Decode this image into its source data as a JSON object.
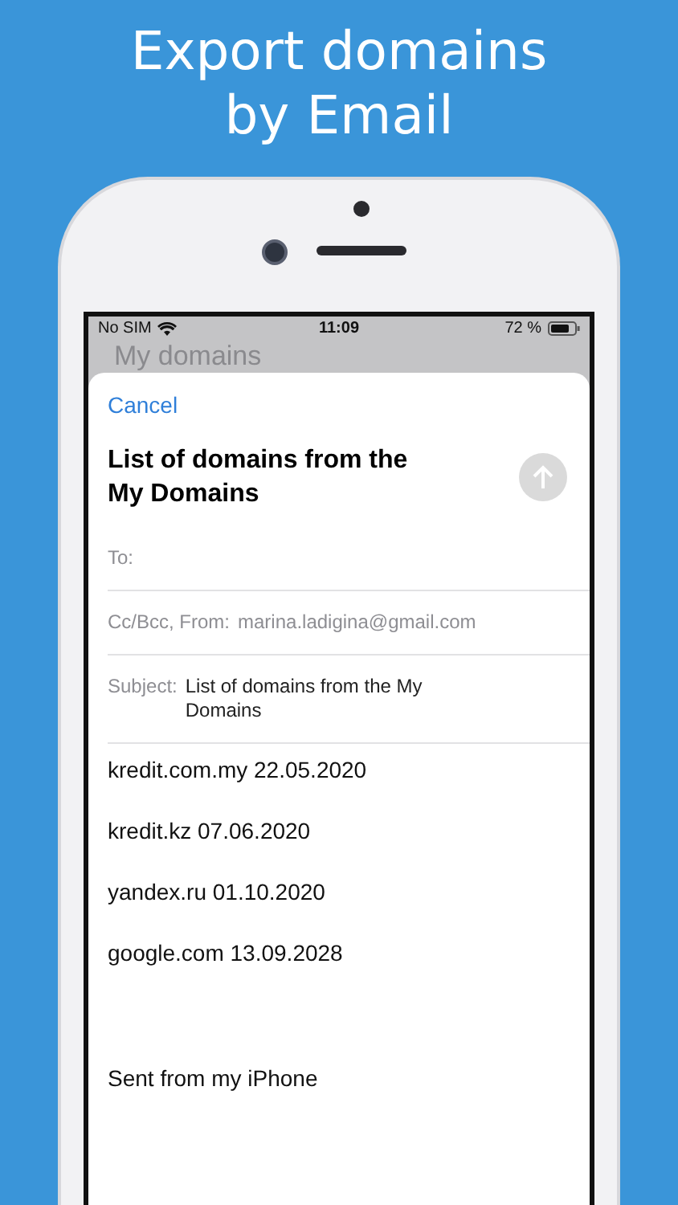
{
  "headline": [
    "Export domains",
    "by Email"
  ],
  "status_bar": {
    "carrier": "No SIM",
    "time": "11:09",
    "battery": "72 %"
  },
  "background_title": "My domains",
  "compose": {
    "cancel": "Cancel",
    "title": "List of domains from the My Domains",
    "send_disabled": true,
    "fields": [
      {
        "label": "To:"
      },
      {
        "label": "Cc/Bcc, From:",
        "value": "marina.ladigina@gmail.com"
      },
      {
        "label": "Subject:",
        "value": "List of domains from the My Domains"
      }
    ],
    "body": [
      "kredit.com.my 22.05.2020",
      "kredit.kz 07.06.2020",
      "yandex.ru 01.10.2020",
      "google.com 13.09.2028"
    ],
    "signature": "Sent from my iPhone"
  }
}
